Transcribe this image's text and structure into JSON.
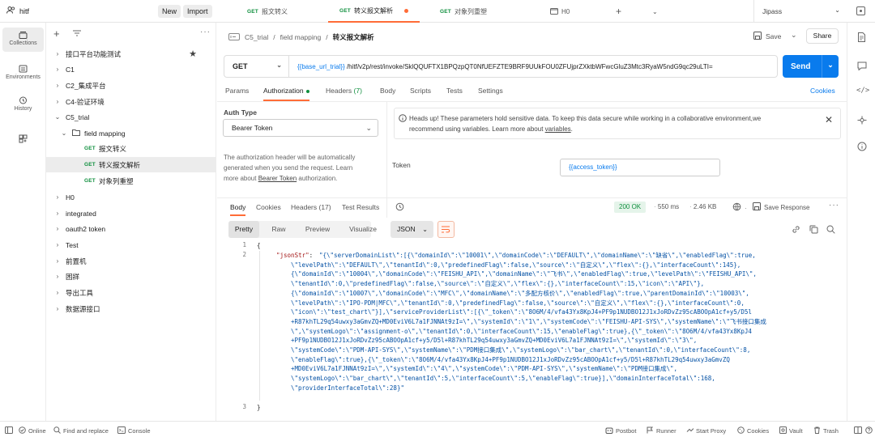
{
  "workspace": {
    "name": "hitf",
    "new_label": "New",
    "import_label": "Import"
  },
  "tabs": [
    {
      "method": "GET",
      "label": "报文转义"
    },
    {
      "method": "GET",
      "label": "转义报文解析"
    },
    {
      "method": "GET",
      "label": "对象列重塑"
    },
    {
      "label": "H0"
    }
  ],
  "environment": {
    "selected": "Jipass"
  },
  "rail": [
    {
      "label": "Collections"
    },
    {
      "label": "Environments"
    },
    {
      "label": "History"
    }
  ],
  "sidebar": {
    "items": [
      {
        "label": "接口平台功能测试"
      },
      {
        "label": "C1"
      },
      {
        "label": "C2_集成平台"
      },
      {
        "label": "C4-验证环境"
      },
      {
        "label": "C5_trial"
      },
      {
        "label": "field mapping"
      },
      {
        "method": "GET",
        "label": "报文转义"
      },
      {
        "method": "GET",
        "label": "转义报文解析"
      },
      {
        "method": "GET",
        "label": "对象列重塑"
      },
      {
        "label": "H0"
      },
      {
        "label": "integrated"
      },
      {
        "label": "oauth2 token"
      },
      {
        "label": "Test"
      },
      {
        "label": "前置机"
      },
      {
        "label": "困牂"
      },
      {
        "label": "导出工具"
      },
      {
        "label": "数据源接口"
      }
    ]
  },
  "breadcrumb": {
    "root": "C5_trial",
    "sep": "/",
    "folder": "field mapping",
    "current": "转义报文解析"
  },
  "actions": {
    "save": "Save",
    "share": "Share"
  },
  "request": {
    "method": "GET",
    "url_var": "{{base_url_trial}}",
    "url_rest": " /hitf/v2p/rest/invoke/SklQQUFTX1BPQzpQT0NfUEFZTE9BRF9UUkFOU0ZFUjprZXktbWFwcGluZ3Mtc3RyaW5ndG9qc29uLTI=",
    "send": "Send"
  },
  "req_tabs": {
    "params": "Params",
    "authorization": "Authorization",
    "headers": "Headers",
    "headers_count": "(7)",
    "body": "Body",
    "scripts": "Scripts",
    "tests": "Tests",
    "settings": "Settings",
    "cookies": "Cookies"
  },
  "auth": {
    "type_label": "Auth Type",
    "type_value": "Bearer Token",
    "desc_1": "The authorization header will be automatically",
    "desc_2": "generated when you send the request. Learn",
    "desc_3a": "more about ",
    "desc_3link": "Bearer Token",
    "desc_3b": " authorization.",
    "banner_1": "Heads up! These parameters hold sensitive data. To keep this data secure while working in a collaborative environment,we",
    "banner_2a": "recommend using variables. Learn more about ",
    "banner_2link": "variables",
    "banner_2b": ".",
    "token_label": "Token",
    "token_value": "{{access_token}}"
  },
  "resp_tabs": {
    "body": "Body",
    "cookies": "Cookies",
    "headers": "Headers (17)",
    "test_results": "Test Results"
  },
  "response": {
    "status": "200 OK",
    "time": "550 ms",
    "size": "2.46 KB",
    "save": "Save Response"
  },
  "view": {
    "pretty": "Pretty",
    "raw": "Raw",
    "preview": "Preview",
    "visualize": "Visualize",
    "format": "JSON"
  },
  "code": {
    "line1": "{",
    "line1_no": "1",
    "line2_no": "2",
    "line3_no": "3",
    "key": "\"jsonStr\"",
    "colon": ": ",
    "value_lines": [
      "\"{\\\"serverDomainList\\\":[{\\\"domainId\\\":\\\"10001\\\",\\\"domainCode\\\":\\\"DEFAULT\\\",\\\"domainName\\\":\\\"缺省\\\",\\\"enabledFlag\\\":true,",
      "\\\"levelPath\\\":\\\"DEFAULT\\\",\\\"tenantId\\\":0,\\\"predefinedFlag\\\":false,\\\"source\\\":\\\"自定义\\\",\\\"flex\\\":{},\\\"interfaceCount\\\":145},",
      "{\\\"domainId\\\":\\\"10004\\\",\\\"domainCode\\\":\\\"FEISHU_API\\\",\\\"domainName\\\":\\\"飞书\\\",\\\"enabledFlag\\\":true,\\\"levelPath\\\":\\\"FEISHU_API\\\",",
      "\\\"tenantId\\\":0,\\\"predefinedFlag\\\":false,\\\"source\\\":\\\"自定义\\\",\\\"flex\\\":{},\\\"interfaceCount\\\":15,\\\"icon\\\":\\\"API\\\"},",
      "{\\\"domainId\\\":\\\"10007\\\",\\\"domainCode\\\":\\\"MFC\\\",\\\"domainName\\\":\\\"多配方核价\\\",\\\"enabledFlag\\\":true,\\\"parentDomainId\\\":\\\"10003\\\",",
      "\\\"levelPath\\\":\\\"IPO-PDM|MFC\\\",\\\"tenantId\\\":0,\\\"predefinedFlag\\\":false,\\\"source\\\":\\\"自定义\\\",\\\"flex\\\":{},\\\"interfaceCount\\\":0,",
      "\\\"icon\\\":\\\"test_chart\\\"}],\\\"serviceProviderList\\\":[{\\\"_token\\\":\\\"8O6M/4/vfa43Yx8KpJ4+PF9p1NUDBO12J1xJoRDvZz95cABOOpA1cf+y5/D5l",
      "+R87khTL29q54uwxy3aGmvZQ+MD0EviV6L7a1FJNNAt9zI=\\\",\\\"systemId\\\":\\\"1\\\",\\\"systemCode\\\":\\\"FEISHU-API-SYS\\\",\\\"systemName\\\":\\\"飞书接口集成",
      "\\\",\\\"systemLogo\\\":\\\"assignment-o\\\",\\\"tenantId\\\":0,\\\"interfaceCount\\\":15,\\\"enableFlag\\\":true},{\\\"_token\\\":\\\"8O6M/4/vfa43Yx8KpJ4",
      "+PF9p1NUDBO12J1xJoRDvZz95cABOOpA1cf+y5/D5l+R87khTL29q54uwxy3aGmvZQ+MD0EviV6L7a1FJNNAt9zI=\\\",\\\"systemId\\\":\\\"3\\\",",
      "\\\"systemCode\\\":\\\"PDM-API-SYS\\\",\\\"systemName\\\":\\\"PDM接口集成\\\",\\\"systemLogo\\\":\\\"bar_chart\\\",\\\"tenantId\\\":0,\\\"interfaceCount\\\":8,",
      "\\\"enableFlag\\\":true},{\\\"_token\\\":\\\"8O6M/4/vfa43Yx8KpJ4+PF9p1NUDBO12J1xJoRDvZz95cABOOpA1cf+y5/D5l+R87khTL29q54uwxy3aGmvZQ",
      "+MD0EviV6L7a1FJNNAt9zI=\\\",\\\"systemId\\\":\\\"4\\\",\\\"systemCode\\\":\\\"PDM-API-SYS\\\",\\\"systemName\\\":\\\"PDM接口集成\\\",",
      "\\\"systemLogo\\\":\\\"bar_chart\\\",\\\"tenantId\\\":5,\\\"interfaceCount\\\":5,\\\"enableFlag\\\":true}],\\\"domainInterfaceTotal\\\":168,",
      "\\\"providerInterfaceTotal\\\":28}\""
    ],
    "line3": "}"
  },
  "statusbar": {
    "online": "Online",
    "find_replace": "Find and replace",
    "console": "Console",
    "postbot": "Postbot",
    "runner": "Runner",
    "start_proxy": "Start Proxy",
    "cookies": "Cookies",
    "vault": "Vault",
    "trash": "Trash"
  },
  "colors": {
    "accent": "#ff6c37",
    "send": "#097bed",
    "get": "#0f8f3e",
    "ok": "#0f8f3e"
  }
}
